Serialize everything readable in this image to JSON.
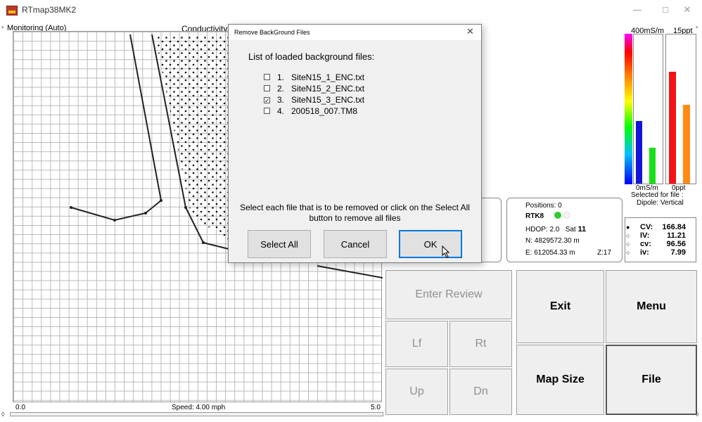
{
  "window": {
    "title": "RTmap38MK2",
    "minimize_glyph": "—",
    "maximize_glyph": "☐",
    "close_glyph": "✕"
  },
  "map": {
    "mode_label": "Monitoring (Auto)",
    "layer_label": "Conductivity",
    "left_value": "0.0",
    "speed_label": "Speed:  4.00 mph",
    "right_value": "5.0",
    "corner_tl": "°",
    "corner_tr": "°",
    "corner_bl": "◊",
    "corner_br": "◊"
  },
  "meters": {
    "top_left_label": "400mS/m",
    "top_right_label": "15ppt",
    "bottom_left_label": "0mS/m",
    "bottom_right_label": "0ppt",
    "selected_for_file": "Selected for file :",
    "dipole": "Dipole: Vertical",
    "colors": {
      "blue": "#1515d8",
      "green": "#18e018",
      "red": "#f21414",
      "orange": "#ff8a14"
    },
    "levels": {
      "conductivity_blue": 0.42,
      "conductivity_green": 0.24,
      "salinity_red": 0.75,
      "salinity_orange": 0.53
    }
  },
  "readouts": [
    {
      "radio": "●",
      "label": "CV:",
      "value": "166.84"
    },
    {
      "radio": "○",
      "label": "IV:",
      "value": "11.21"
    },
    {
      "radio": "○",
      "label": "cv:",
      "value": "96.56"
    },
    {
      "radio": "○",
      "label": "iv:",
      "value": "7.99"
    }
  ],
  "gps": {
    "positions": "Positions:  0",
    "mode": "RTK8",
    "hdop": "HDOP: 2.0",
    "sat_label": "Sat",
    "sat_value": "11",
    "northing": "N:  4829572.30 m",
    "easting": "E:  612054.33 m",
    "zone": "Z:17"
  },
  "commands": {
    "enter_review": "Enter Review",
    "exit": "Exit",
    "menu": "Menu",
    "left": "Lf",
    "right": "Rt",
    "up": "Up",
    "down": "Dn",
    "map_size": "Map Size",
    "file": "File"
  },
  "dialog": {
    "title": "Remove BackGround Files",
    "close_glyph": "✕",
    "heading": "List of loaded background files:",
    "files": [
      {
        "number": "1.",
        "name": "SiteN15_1_ENC.txt",
        "checked": false
      },
      {
        "number": "2.",
        "name": "SiteN15_2_ENC.txt",
        "checked": false
      },
      {
        "number": "3.",
        "name": "SiteN15_3_ENC.txt",
        "checked": true
      },
      {
        "number": "4.",
        "name": "200518_007.TM8",
        "checked": false
      }
    ],
    "instructions": "Select each file that is to be removed or click on the Select All button to remove all files",
    "select_all_label": "Select All",
    "cancel_label": "Cancel",
    "ok_label": "OK"
  }
}
